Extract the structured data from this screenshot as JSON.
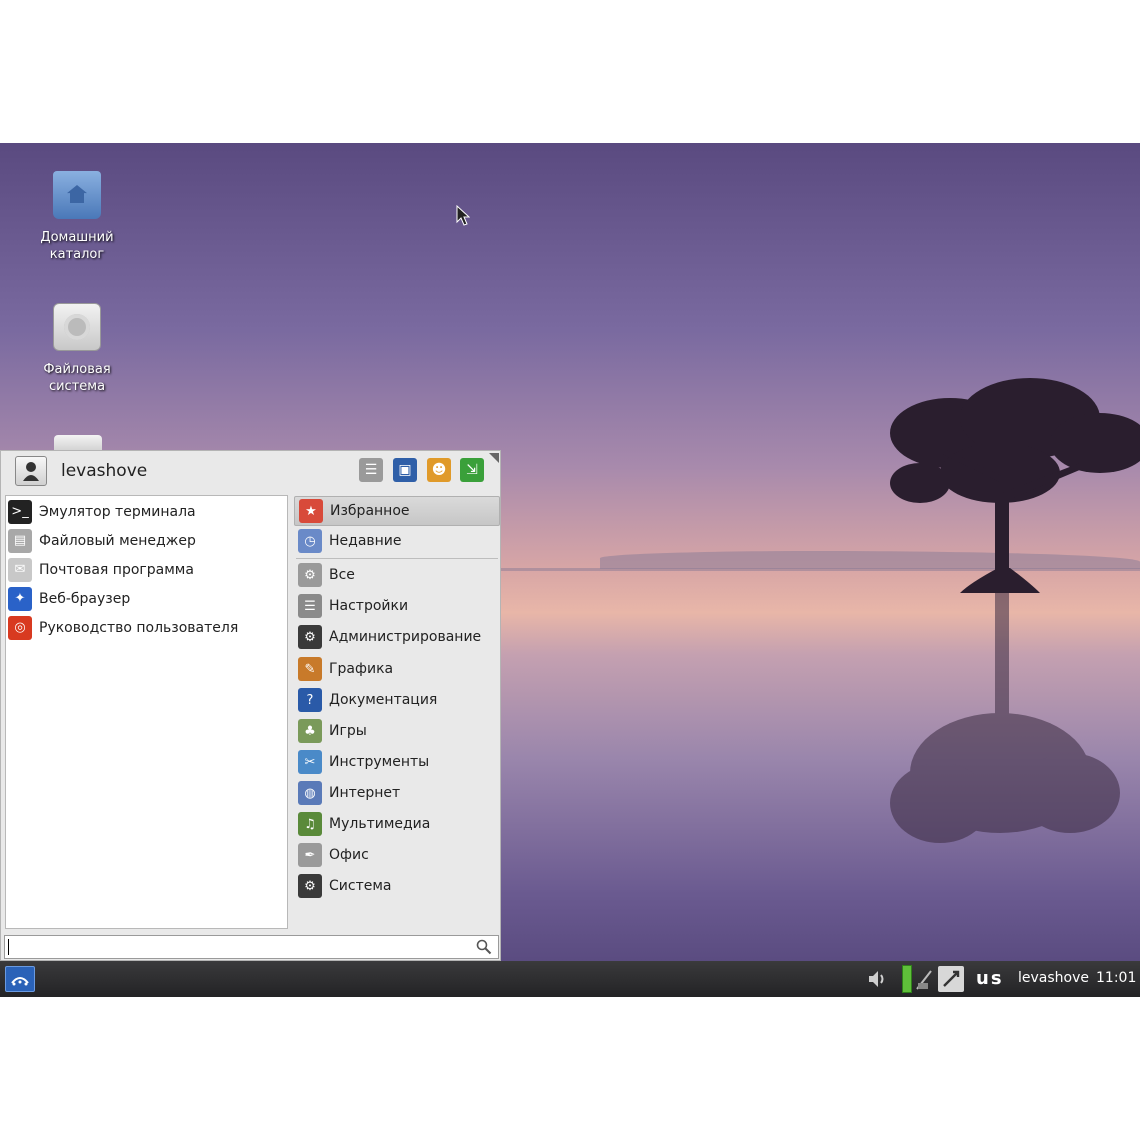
{
  "desktop": {
    "icons": [
      {
        "label": "Домашний каталог",
        "icon": "home-folder-icon"
      },
      {
        "label": "Файловая система",
        "icon": "filesystem-drive-icon"
      }
    ]
  },
  "menu": {
    "user": "levashove",
    "header_buttons": [
      {
        "icon": "settings-icon",
        "color": "#8a8a8a"
      },
      {
        "icon": "lock-screen-icon",
        "color": "#2f5fa8"
      },
      {
        "icon": "switch-user-icon",
        "color": "#e09a2a"
      },
      {
        "icon": "logout-icon",
        "color": "#3aa03a"
      }
    ],
    "favorites": [
      {
        "label": "Эмулятор терминала",
        "icon": "terminal-icon",
        "color": "#222222",
        "glyph": ">_"
      },
      {
        "label": "Файловый менеджер",
        "icon": "file-manager-icon",
        "color": "#a8a8a8",
        "glyph": "▤"
      },
      {
        "label": "Почтовая программа",
        "icon": "mail-icon",
        "color": "#c8c8c8",
        "glyph": "✉"
      },
      {
        "label": "Веб-браузер",
        "icon": "web-browser-icon",
        "color": "#2a62c8",
        "glyph": "✦"
      },
      {
        "label": "Руководство пользователя",
        "icon": "help-lifebuoy-icon",
        "color": "#d83a20",
        "glyph": "◎"
      }
    ],
    "categories": [
      {
        "label": "Избранное",
        "icon": "favorites-icon",
        "color": "#d84a3a",
        "glyph": "★",
        "selected": true
      },
      {
        "label": "Недавние",
        "icon": "recent-icon",
        "color": "#6a8ac8",
        "glyph": "◷"
      },
      {
        "label": "Все",
        "icon": "all-apps-icon",
        "color": "#9a9a9a",
        "glyph": "⚙"
      },
      {
        "label": "Настройки",
        "icon": "settings-category-icon",
        "color": "#8a8a8a",
        "glyph": "☰"
      },
      {
        "label": "Администрирование",
        "icon": "administration-icon",
        "color": "#3a3a3a",
        "glyph": "⚙"
      },
      {
        "label": "Графика",
        "icon": "graphics-icon",
        "color": "#c87a2a",
        "glyph": "✎"
      },
      {
        "label": "Документация",
        "icon": "documentation-icon",
        "color": "#2a5aa8",
        "glyph": "?"
      },
      {
        "label": "Игры",
        "icon": "games-icon",
        "color": "#7a9a5a",
        "glyph": "♣"
      },
      {
        "label": "Инструменты",
        "icon": "tools-icon",
        "color": "#4a8ac8",
        "glyph": "✂"
      },
      {
        "label": "Интернет",
        "icon": "internet-icon",
        "color": "#5a7ab8",
        "glyph": "◍"
      },
      {
        "label": "Мультимедиа",
        "icon": "multimedia-icon",
        "color": "#5a8a3a",
        "glyph": "♫"
      },
      {
        "label": "Офис",
        "icon": "office-icon",
        "color": "#9a9a9a",
        "glyph": "✒"
      },
      {
        "label": "Система",
        "icon": "system-icon",
        "color": "#3a3a3a",
        "glyph": "⚙"
      }
    ],
    "search": {
      "value": "",
      "placeholder": ""
    }
  },
  "panel": {
    "start_icon": "start-menu-icon",
    "tray": [
      {
        "icon": "volume-icon"
      },
      {
        "icon": "battery-icon"
      },
      {
        "icon": "network-icon"
      },
      {
        "icon": "no-connection-icon"
      }
    ],
    "keyboard_layout": "us",
    "user": "levashove",
    "clock": "11:01"
  }
}
